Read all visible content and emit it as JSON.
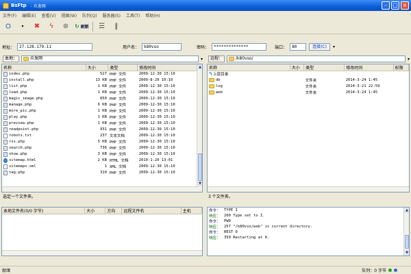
{
  "window": {
    "title": "BsFtp",
    "subtitle": "- 众发网"
  },
  "colors": {
    "accent": "#0a5fd8",
    "folder": "#f5cf5b",
    "status_ok": "#22a022",
    "status_busy": "#3366cc"
  },
  "menu": [
    "文件(F)",
    "编辑(E)",
    "查看(V)",
    "视图(W)",
    "队列(Q)",
    "服务器(S)",
    "工具(T)",
    "帮助(H)"
  ],
  "toolbar": {
    "quick_connect": "刷新"
  },
  "address": {
    "host_label": "地址：",
    "host_value": "27.128.179.11",
    "user_label": "用户名：",
    "user_value": "k80vso",
    "pass_label": "密码：",
    "pass_value": "**************",
    "port_label": "端口：",
    "port_value": "80",
    "connect_label": "连接(C)"
  },
  "local": {
    "path_label": "本地：",
    "path_value": "众发网",
    "columns": [
      "名称",
      "大小",
      "类型",
      "修改时间"
    ],
    "files": [
      {
        "name": "index.php",
        "size": "527",
        "type": "PHP 文件",
        "date": "2009-12-30 15:10",
        "icon": "php"
      },
      {
        "name": "install.php",
        "size": "13 KB",
        "type": "PHP 文件",
        "date": "2009-8-20 10:10",
        "icon": "php"
      },
      {
        "name": "list.php",
        "size": "1 KB",
        "type": "PHP 文件",
        "date": "2009-12-30 15:10",
        "icon": "php"
      },
      {
        "name": "load.php",
        "size": "1 KB",
        "type": "PHP 文件",
        "date": "2009-12-30 15:10",
        "icon": "php"
      },
      {
        "name": "magic_image.php",
        "size": "850",
        "type": "PHP 文件",
        "date": "2009-12-30 15:10",
        "icon": "php"
      },
      {
        "name": "manage.php",
        "size": "6 KB",
        "type": "PHP 文件",
        "date": "2009-12-30 15:10",
        "icon": "php"
      },
      {
        "name": "more_pic.php",
        "size": "1 KB",
        "type": "PHP 文件",
        "date": "2009-12-30 15:10",
        "icon": "php"
      },
      {
        "name": "play.php",
        "size": "1 KB",
        "type": "PHP 文件",
        "date": "2009-12-30 15:10",
        "icon": "php"
      },
      {
        "name": "preview.php",
        "size": "1 KB",
        "type": "PHP 文件",
        "date": "2009-12-30 15:10",
        "icon": "php"
      },
      {
        "name": "readpoint.php",
        "size": "931",
        "type": "PHP 文件",
        "date": "2009-12-30 15:10",
        "icon": "php"
      },
      {
        "name": "robots.txt",
        "size": "237",
        "type": "文本文档",
        "date": "2009-12-30 15:10",
        "icon": "txt"
      },
      {
        "name": "rss.php",
        "size": "5 KB",
        "type": "PHP 文件",
        "date": "2009-12-30 15:10",
        "icon": "php"
      },
      {
        "name": "search.php",
        "size": "736",
        "type": "PHP 文件",
        "date": "2009-12-30 15:10",
        "icon": "php"
      },
      {
        "name": "show.php",
        "size": "3 KB",
        "type": "PHP 文件",
        "date": "2009-12-30 15:10",
        "icon": "php"
      },
      {
        "name": "sitemap.html",
        "size": "2 KB",
        "type": "HTML 文档",
        "date": "2010-1-20 13:01",
        "icon": "html"
      },
      {
        "name": "sitemaps.xml",
        "size": "1",
        "type": "XML 文档",
        "date": "2009-12-30 15:10",
        "icon": "txt"
      },
      {
        "name": "tag.php",
        "size": "310",
        "type": "PHP 文件",
        "date": "2009-12-30 15:10",
        "icon": "php"
      }
    ],
    "status": "选定一个文件夹。"
  },
  "remote": {
    "path_label": "远程：",
    "path_value": "/k80vso/",
    "columns": [
      "名称",
      "大小",
      "类型",
      "修改时间",
      "权限"
    ],
    "files": [
      {
        "name": "上层目录",
        "size": "",
        "type": "",
        "date": "",
        "icon": "up"
      },
      {
        "name": "db",
        "size": "",
        "type": "文件夹",
        "date": "2014-3-24 1:45",
        "icon": "folder"
      },
      {
        "name": "log",
        "size": "",
        "type": "文件夹",
        "date": "2014-3-21 22:59",
        "icon": "folder"
      },
      {
        "name": "web",
        "size": "",
        "type": "文件夹",
        "date": "2014-3-24 1:45",
        "icon": "folder"
      }
    ],
    "status": "3 个文件夹。"
  },
  "queue": {
    "columns": [
      "本地文件名(0/0 字节)",
      "大小",
      "方向",
      "远程文件名",
      "主机"
    ]
  },
  "log": [
    {
      "label": "命令：",
      "kind": "cmd",
      "text": "TYPE I"
    },
    {
      "label": "响应：",
      "kind": "resp",
      "text": "200 Type set to I."
    },
    {
      "label": "命令：",
      "kind": "cmd",
      "text": "PWD"
    },
    {
      "label": "响应：",
      "kind": "resp",
      "text": "257 \"/k80vso/web\" is current directory."
    },
    {
      "label": "命令：",
      "kind": "cmd",
      "text": "REST 0"
    },
    {
      "label": "响应：",
      "kind": "resp",
      "text": "350 Restarting at 0."
    }
  ],
  "statusbar": {
    "left": "就绪",
    "queue": "队列：0 字节"
  }
}
